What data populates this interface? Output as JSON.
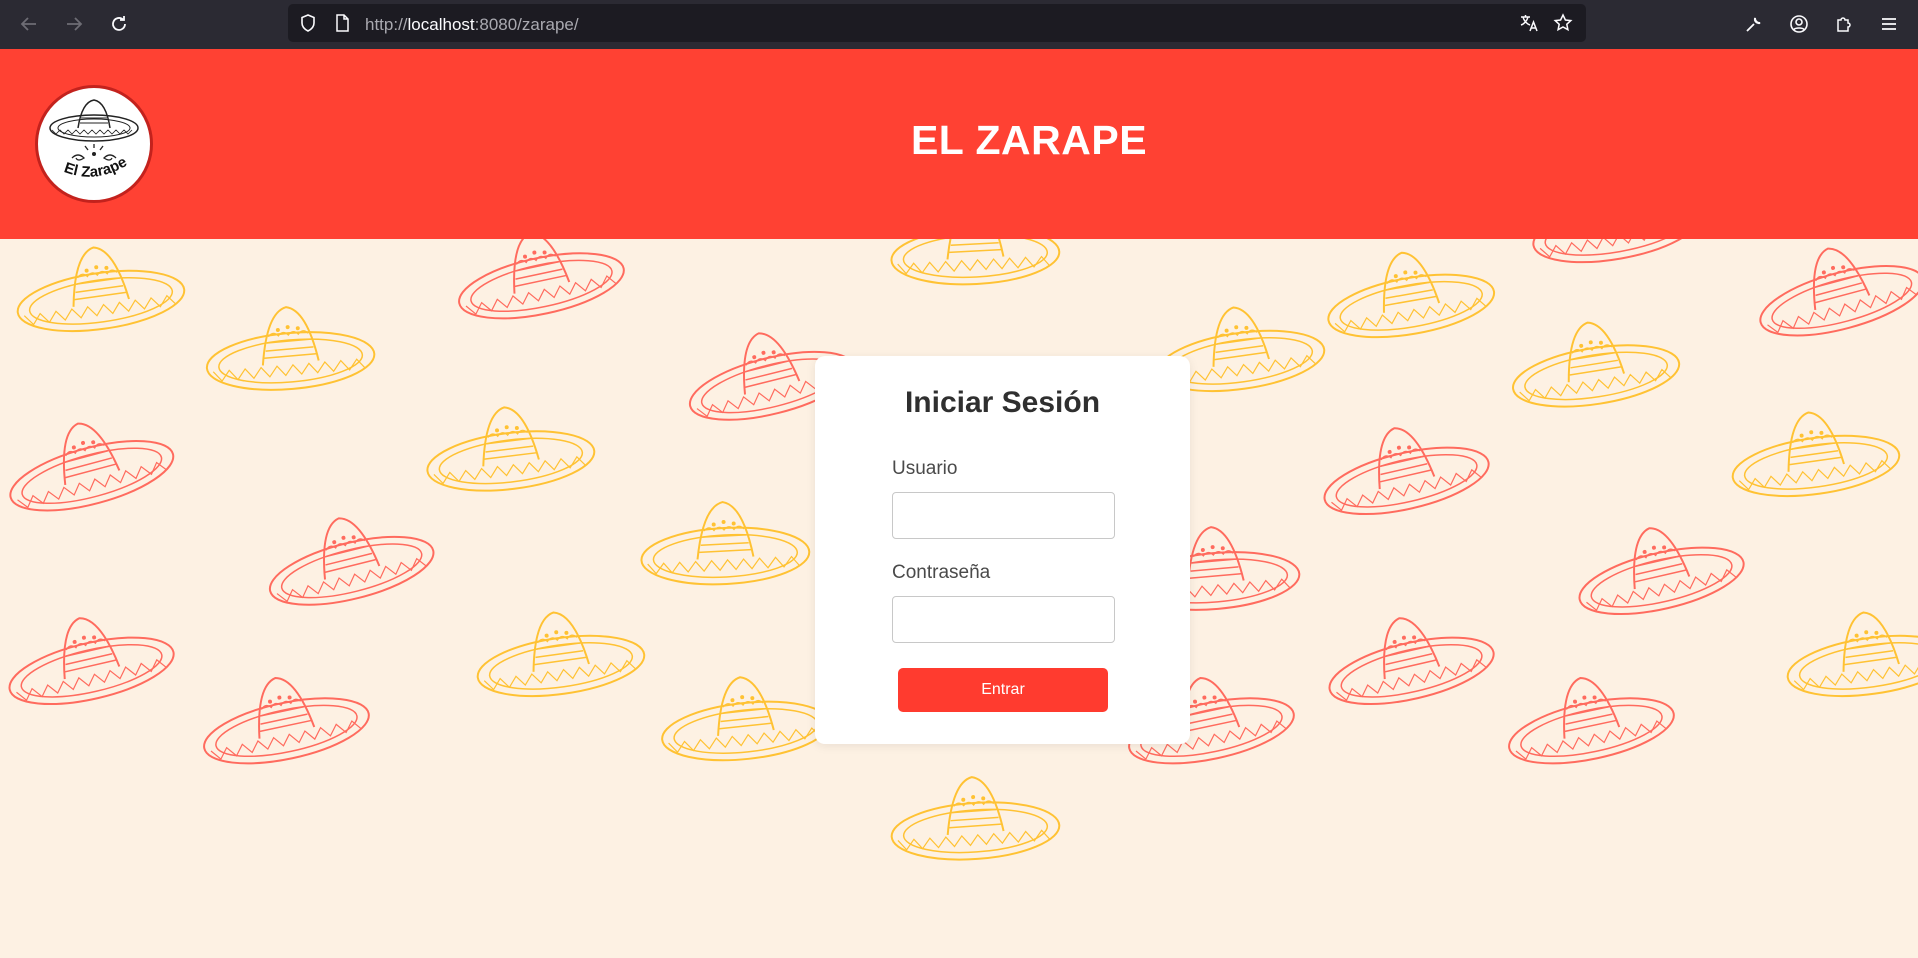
{
  "browser": {
    "url_prefix": "http://",
    "url_host": "localhost",
    "url_rest": ":8080/zarape/"
  },
  "header": {
    "title": "EL ZARAPE",
    "logo_text": "El Zarape",
    "color": "#ff4133"
  },
  "login": {
    "title": "Iniciar Sesión",
    "username_label": "Usuario",
    "username_value": "",
    "password_label": "Contraseña",
    "password_value": "",
    "submit_label": "Entrar",
    "button_color": "#ff3b2f"
  },
  "background": {
    "color": "#fdf1e3",
    "pattern_icon": "sombrero-icon",
    "pattern_colors": [
      "#ff6b5e",
      "#ffc233"
    ]
  }
}
